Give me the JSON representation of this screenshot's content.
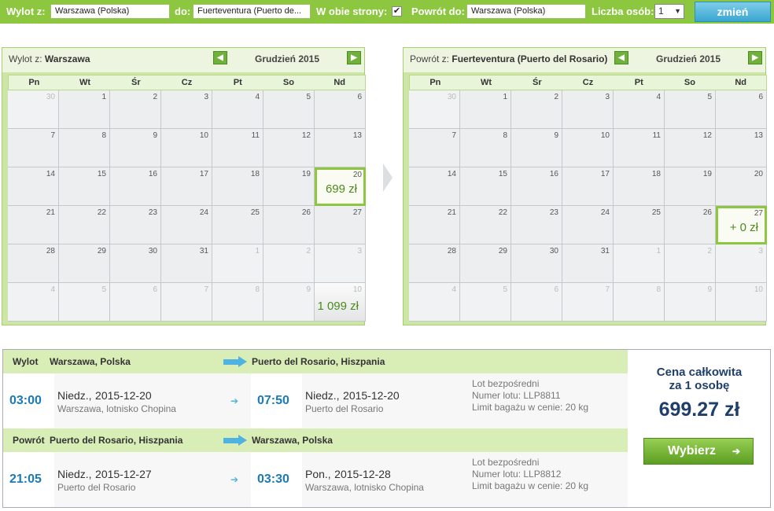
{
  "topbar": {
    "from_label": "Wylot z:",
    "from_value": "Warszawa (Polska)",
    "to_label": "do:",
    "to_value": "Fuerteventura (Puerto de...",
    "roundtrip_label": "W obie strony:",
    "roundtrip_checked": "✔",
    "return_label": "Powrót do:",
    "return_value": "Warszawa (Polska)",
    "people_label": "Liczba osób:",
    "people_value": "1",
    "change_button": "zmień"
  },
  "calendars": [
    {
      "title_prefix": "Wylot z:",
      "title_city": "Warszawa",
      "month": "Grudzień 2015",
      "weekdays": [
        "Pn",
        "Wt",
        "Śr",
        "Cz",
        "Pt",
        "So",
        "Nd"
      ],
      "weeks": [
        [
          {
            "n": "30",
            "o": true
          },
          {
            "n": "1"
          },
          {
            "n": "2"
          },
          {
            "n": "3"
          },
          {
            "n": "4"
          },
          {
            "n": "5"
          },
          {
            "n": "6"
          }
        ],
        [
          {
            "n": "7"
          },
          {
            "n": "8"
          },
          {
            "n": "9"
          },
          {
            "n": "10"
          },
          {
            "n": "11"
          },
          {
            "n": "12"
          },
          {
            "n": "13"
          }
        ],
        [
          {
            "n": "14"
          },
          {
            "n": "15"
          },
          {
            "n": "16"
          },
          {
            "n": "17"
          },
          {
            "n": "18"
          },
          {
            "n": "19"
          },
          {
            "n": "20",
            "price": "699 zł",
            "sel": true
          }
        ],
        [
          {
            "n": "21"
          },
          {
            "n": "22"
          },
          {
            "n": "23"
          },
          {
            "n": "24"
          },
          {
            "n": "25"
          },
          {
            "n": "26"
          },
          {
            "n": "27"
          }
        ],
        [
          {
            "n": "28"
          },
          {
            "n": "29"
          },
          {
            "n": "30"
          },
          {
            "n": "31"
          },
          {
            "n": "1",
            "o": true
          },
          {
            "n": "2",
            "o": true
          },
          {
            "n": "3",
            "o": true
          }
        ],
        [
          {
            "n": "4",
            "o": true
          },
          {
            "n": "5",
            "o": true
          },
          {
            "n": "6",
            "o": true
          },
          {
            "n": "7",
            "o": true
          },
          {
            "n": "8",
            "o": true
          },
          {
            "n": "9",
            "o": true
          },
          {
            "n": "10",
            "o": true,
            "price": "1 099 zł",
            "grey": true
          }
        ]
      ]
    },
    {
      "title_prefix": "Powrót z:",
      "title_city": "Fuerteventura (Puerto del Rosario)",
      "month": "Grudzień 2015",
      "weekdays": [
        "Pn",
        "Wt",
        "Śr",
        "Cz",
        "Pt",
        "So",
        "Nd"
      ],
      "weeks": [
        [
          {
            "n": "30",
            "o": true
          },
          {
            "n": "1"
          },
          {
            "n": "2"
          },
          {
            "n": "3"
          },
          {
            "n": "4"
          },
          {
            "n": "5"
          },
          {
            "n": "6"
          }
        ],
        [
          {
            "n": "7"
          },
          {
            "n": "8"
          },
          {
            "n": "9"
          },
          {
            "n": "10"
          },
          {
            "n": "11"
          },
          {
            "n": "12"
          },
          {
            "n": "13"
          }
        ],
        [
          {
            "n": "14"
          },
          {
            "n": "15"
          },
          {
            "n": "16"
          },
          {
            "n": "17"
          },
          {
            "n": "18"
          },
          {
            "n": "19"
          },
          {
            "n": "20"
          }
        ],
        [
          {
            "n": "21"
          },
          {
            "n": "22"
          },
          {
            "n": "23"
          },
          {
            "n": "24"
          },
          {
            "n": "25"
          },
          {
            "n": "26"
          },
          {
            "n": "27",
            "price": "+ 0 zł",
            "sel": true
          }
        ],
        [
          {
            "n": "28"
          },
          {
            "n": "29"
          },
          {
            "n": "30"
          },
          {
            "n": "31"
          },
          {
            "n": "1",
            "o": true
          },
          {
            "n": "2",
            "o": true
          },
          {
            "n": "3",
            "o": true
          }
        ],
        [
          {
            "n": "4",
            "o": true
          },
          {
            "n": "5",
            "o": true
          },
          {
            "n": "6",
            "o": true
          },
          {
            "n": "7",
            "o": true
          },
          {
            "n": "8",
            "o": true
          },
          {
            "n": "9",
            "o": true
          },
          {
            "n": "10",
            "o": true
          }
        ]
      ]
    }
  ],
  "summary": {
    "outbound": {
      "label": "Wylot",
      "from_city": "Warszawa, Polska",
      "to_city": "Puerto del Rosario, Hiszpania",
      "dep_time": "03:00",
      "dep_day": "Niedz.,",
      "dep_date": "2015-12-20",
      "dep_airport": "Warszawa, lotnisko Chopina",
      "arr_time": "07:50",
      "arr_day": "Niedz.,",
      "arr_date": "2015-12-20",
      "arr_airport": "Puerto del Rosario",
      "info1": "Lot bezpośredni",
      "info2": "Numer lotu: LLP8811",
      "info3": "Limit bagażu w cenie: 20 kg"
    },
    "return": {
      "label": "Powrót",
      "from_city": "Puerto del Rosario, Hiszpania",
      "to_city": "Warszawa, Polska",
      "dep_time": "21:05",
      "dep_day": "Niedz.,",
      "dep_date": "2015-12-27",
      "dep_airport": "Puerto del Rosario",
      "arr_time": "03:30",
      "arr_day": "Pon.,",
      "arr_date": "2015-12-28",
      "arr_airport": "Warszawa, lotnisko Chopina",
      "info1": "Lot bezpośredni",
      "info2": "Numer lotu: LLP8812",
      "info3": "Limit bagażu w cenie: 20 kg"
    },
    "total_caption_1": "Cena całkowita",
    "total_caption_2": "za 1 osobę",
    "total_price": "699.27 zł",
    "choose_button": "Wybierz"
  },
  "colors": {
    "accent_green": "#8dc63f",
    "time_blue": "#1a7ab8",
    "price_navy": "#1f3f6a"
  },
  "icons": {
    "prev": "arrow-left-icon",
    "next": "arrow-right-icon",
    "flight": "arrow-right-icon"
  }
}
